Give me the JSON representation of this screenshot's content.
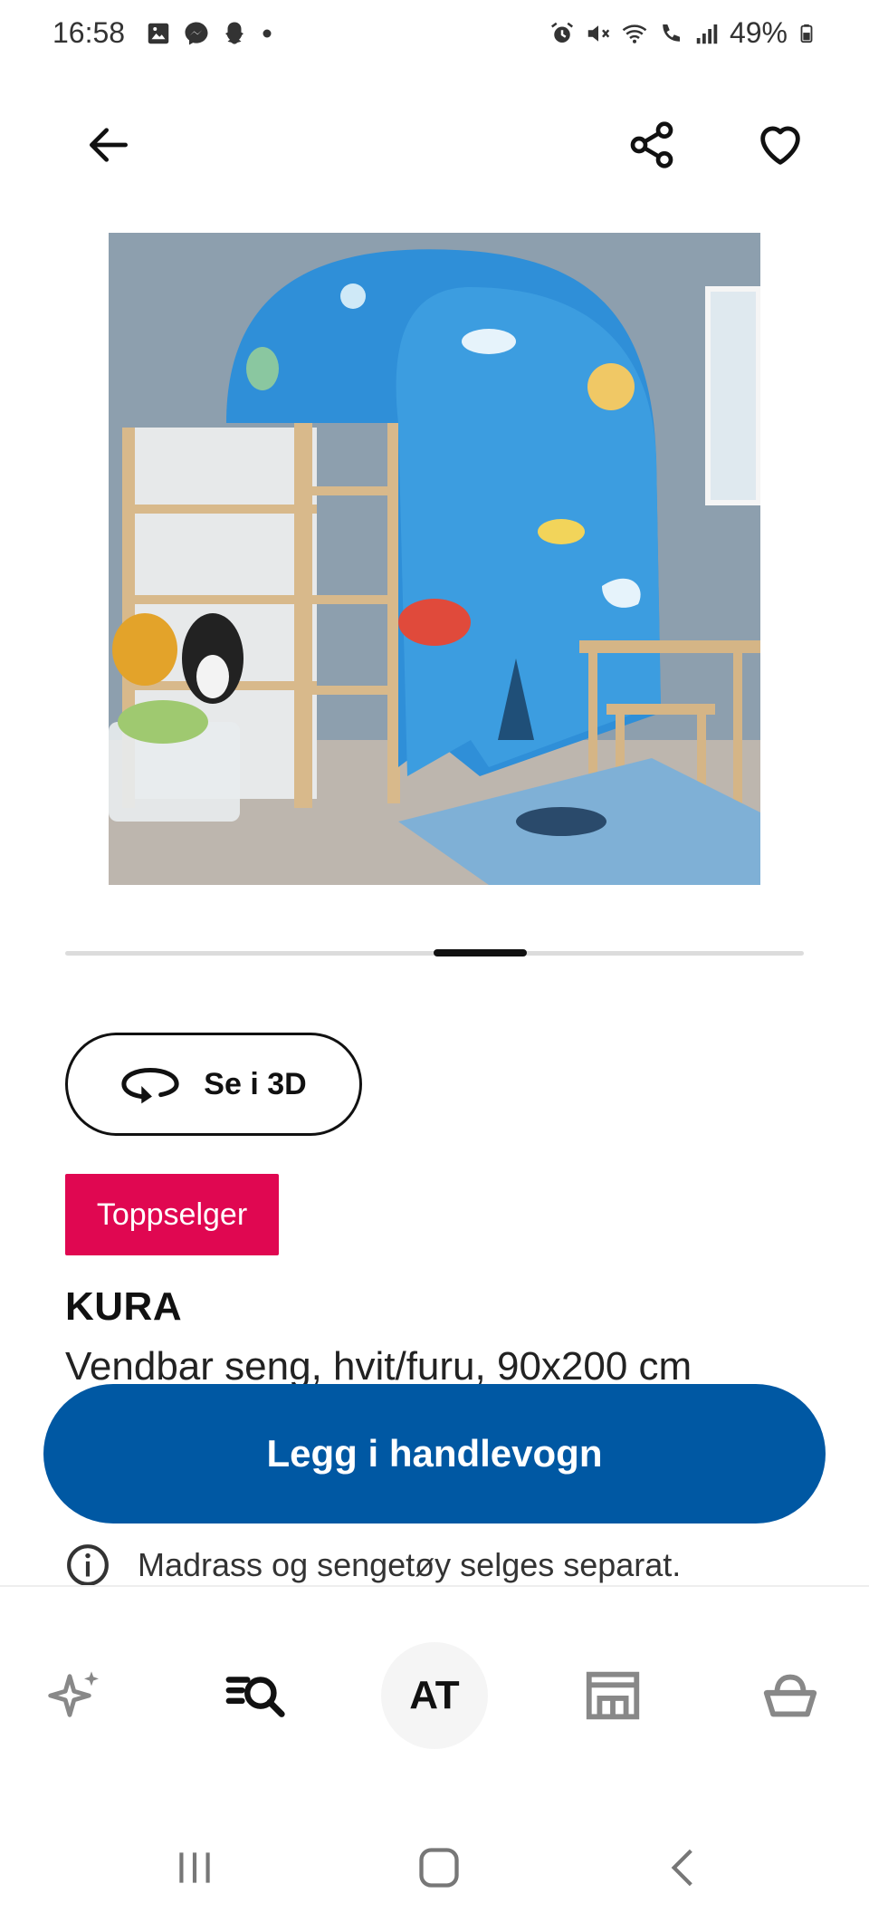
{
  "status_bar": {
    "time": "16:58",
    "battery": "49%",
    "left_icons": [
      "gallery-icon",
      "messenger-icon",
      "snapchat-icon",
      "dot-icon"
    ],
    "right_icons": [
      "alarm-icon",
      "mute-icon",
      "wifi-icon",
      "wifi-call-icon",
      "signal-icon",
      "battery-icon"
    ]
  },
  "header": {
    "back_icon": "arrow-left-icon",
    "share_icon": "share-icon",
    "favorite_icon": "heart-icon"
  },
  "carousel": {
    "active_index_fraction": 0.55
  },
  "view_3d": {
    "label": "Se i 3D",
    "icon": "rotate-3d-icon"
  },
  "badge": {
    "label": "Toppselger",
    "color": "#e00751"
  },
  "product": {
    "name": "KURA",
    "description": "Vendbar seng, hvit/furu, 90x200 cm"
  },
  "cart_button": {
    "label": "Legg i handlevogn",
    "color": "#0058a3"
  },
  "notice": {
    "text": "Madrass og sengetøy selges separat.",
    "icon": "info-icon"
  },
  "bottom_nav": {
    "items": [
      {
        "icon": "sparkle-icon"
      },
      {
        "icon": "search-list-icon"
      },
      {
        "label": "AT"
      },
      {
        "icon": "store-icon"
      },
      {
        "icon": "basket-icon"
      }
    ]
  }
}
